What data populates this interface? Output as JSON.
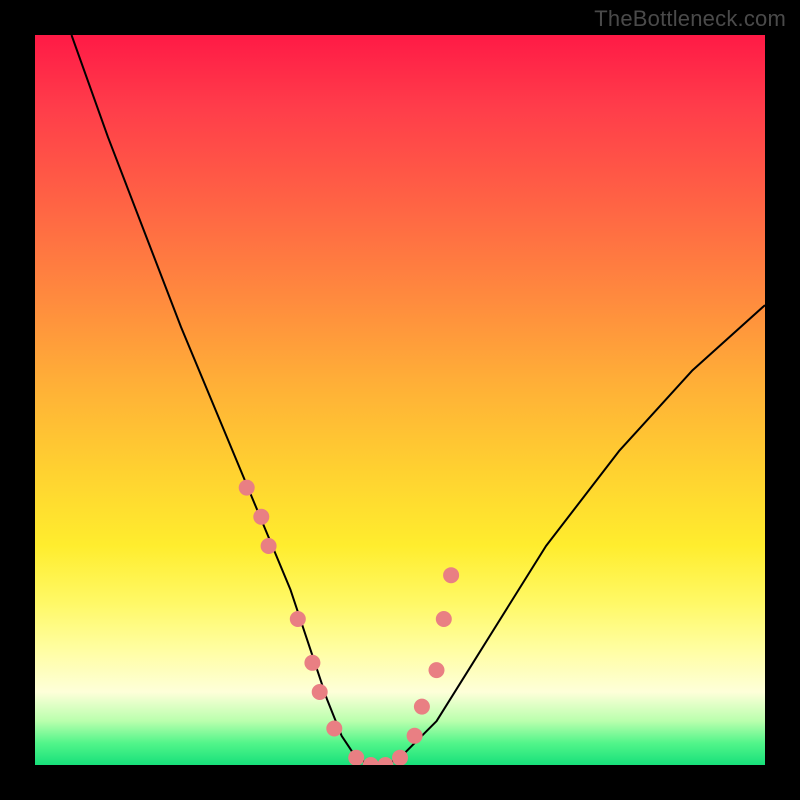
{
  "watermark": "TheBottleneck.com",
  "colors": {
    "gradient_top": "#ff1a46",
    "gradient_bottom": "#17e07a",
    "curve": "#000000",
    "dot": "#e97f83",
    "frame": "#000000"
  },
  "chart_data": {
    "type": "line",
    "title": "",
    "xlabel": "",
    "ylabel": "",
    "xlim": [
      0,
      100
    ],
    "ylim": [
      0,
      100
    ],
    "series": [
      {
        "name": "bottleneck-curve",
        "x": [
          5,
          10,
          15,
          20,
          25,
          30,
          35,
          38,
          40,
          42,
          44,
          46,
          48,
          50,
          55,
          60,
          65,
          70,
          80,
          90,
          100
        ],
        "y": [
          100,
          86,
          73,
          60,
          48,
          36,
          24,
          15,
          9,
          4,
          1,
          0,
          0,
          1,
          6,
          14,
          22,
          30,
          43,
          54,
          63
        ]
      }
    ],
    "scatter_points": {
      "x": [
        29,
        31,
        32,
        36,
        38,
        39,
        41,
        44,
        46,
        48,
        50,
        52,
        53,
        55,
        56,
        57
      ],
      "y": [
        38,
        34,
        30,
        20,
        14,
        10,
        5,
        1,
        0,
        0,
        1,
        4,
        8,
        13,
        20,
        26
      ]
    },
    "color_scale": "bottleneck-severity",
    "grid": false,
    "legend": false
  }
}
